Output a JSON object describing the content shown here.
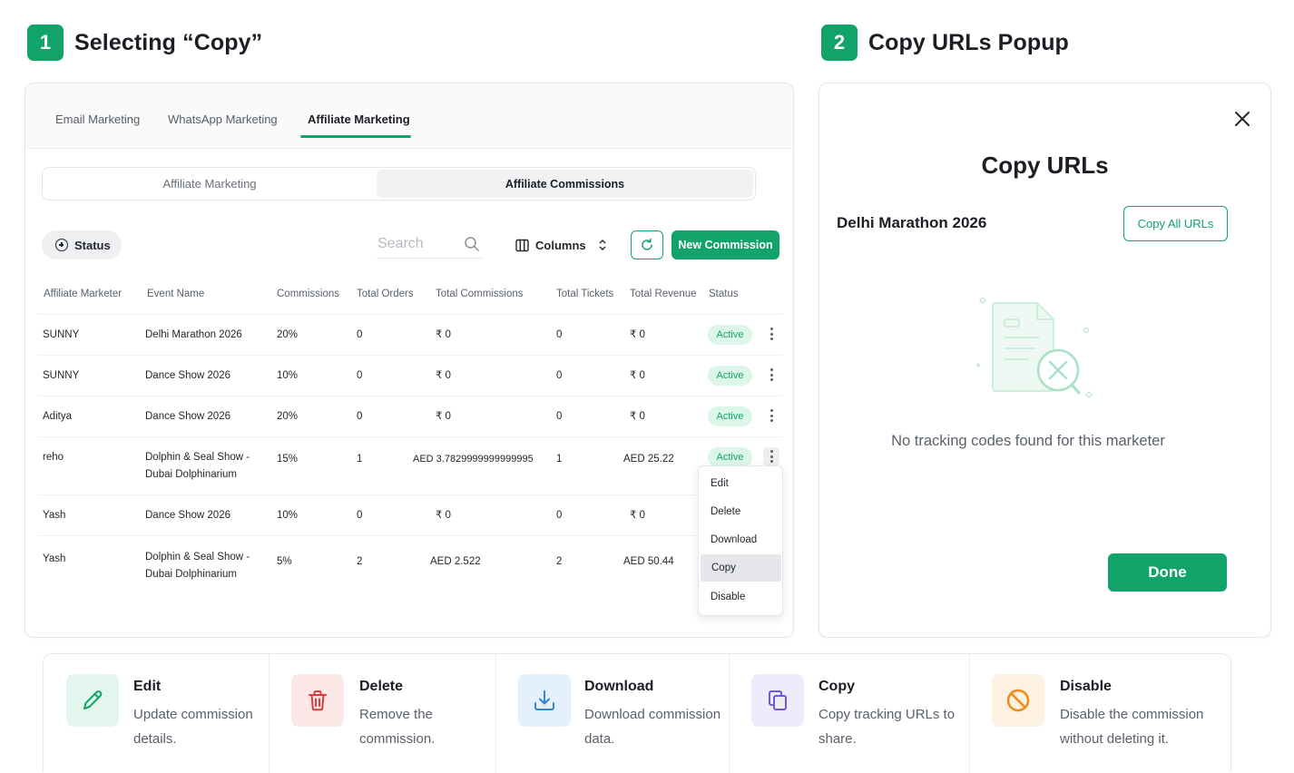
{
  "steps": [
    {
      "number": "1",
      "title": "Selecting “Copy”"
    },
    {
      "number": "2",
      "title": "Copy URLs Popup"
    }
  ],
  "top_tabs": [
    {
      "label": "Email Marketing",
      "active": false
    },
    {
      "label": "WhatsApp Marketing",
      "active": false
    },
    {
      "label": "Affiliate Marketing",
      "active": true
    }
  ],
  "segments": {
    "left": "Affiliate Marketing",
    "right": "Affiliate Commissions",
    "selected": "right"
  },
  "toolbar": {
    "status_label": "Status",
    "search_placeholder": "Search",
    "columns_label": "Columns",
    "new_commission_label": "New Commission"
  },
  "table": {
    "headers": [
      "Affiliate Marketer",
      "Event Name",
      "Commissions",
      "Total Orders",
      "Total Commissions",
      "Total Tickets",
      "Total Revenue",
      "Status"
    ],
    "rows": [
      {
        "marketer": "SUNNY",
        "event": "Delhi Marathon 2026",
        "event2": "",
        "commission": "20%",
        "orders": "0",
        "total_commissions": "₹ 0",
        "tickets": "0",
        "revenue": "₹ 0",
        "status": "Active"
      },
      {
        "marketer": "SUNNY",
        "event": "Dance Show 2026",
        "event2": "",
        "commission": "10%",
        "orders": "0",
        "total_commissions": "₹ 0",
        "tickets": "0",
        "revenue": "₹ 0",
        "status": "Active"
      },
      {
        "marketer": "Aditya",
        "event": "Dance Show 2026",
        "event2": "",
        "commission": "20%",
        "orders": "0",
        "total_commissions": "₹ 0",
        "tickets": "0",
        "revenue": "₹ 0",
        "status": "Active"
      },
      {
        "marketer": "reho",
        "event": "Dolphin & Seal Show -",
        "event2": "Dubai Dolphinarium",
        "commission": "15%",
        "orders": "1",
        "total_commissions": "AED 3.7829999999999995",
        "tickets": "1",
        "revenue": "AED 25.22",
        "status": "Active"
      },
      {
        "marketer": "Yash",
        "event": "Dance Show 2026",
        "event2": "",
        "commission": "10%",
        "orders": "0",
        "total_commissions": "₹ 0",
        "tickets": "0",
        "revenue": "₹ 0",
        "status": ""
      },
      {
        "marketer": "Yash",
        "event": "Dolphin & Seal Show -",
        "event2": "Dubai Dolphinarium",
        "commission": "5%",
        "orders": "2",
        "total_commissions": "AED 2.522",
        "tickets": "2",
        "revenue": "AED 50.44",
        "status": ""
      }
    ]
  },
  "row_menu": {
    "items": [
      "Edit",
      "Delete",
      "Download",
      "Copy",
      "Disable"
    ],
    "highlighted": "Copy"
  },
  "popup": {
    "title": "Copy URLs",
    "event_name": "Delhi Marathon 2026",
    "copy_all_label": "Copy All URLs",
    "empty_message": "No tracking codes found for this marketer",
    "done_label": "Done"
  },
  "legend": [
    {
      "icon": "pencil-icon",
      "title": "Edit",
      "line1": "Update commission",
      "line2": "details.",
      "icon_color": "#12a36b",
      "bg": "#e3f6ee"
    },
    {
      "icon": "trash-icon",
      "title": "Delete",
      "line1": "Remove the",
      "line2": "commission.",
      "icon_color": "#e0393e",
      "bg": "#fde8e8"
    },
    {
      "icon": "download-icon",
      "title": "Download",
      "line1": "Download commission",
      "line2": "data.",
      "icon_color": "#2f86d6",
      "bg": "#e4f0fb"
    },
    {
      "icon": "copy-icon",
      "title": "Copy",
      "line1": "Copy tracking URLs to",
      "line2": "share.",
      "icon_color": "#6b5bd6",
      "bg": "#eeebfb"
    },
    {
      "icon": "disable-icon",
      "title": "Disable",
      "line1": "Disable the commission",
      "line2": "without deleting it.",
      "icon_color": "#ef8a1a",
      "bg": "#fdf1e1"
    }
  ],
  "colors": {
    "accent": "#12a36b",
    "badge_bg": "#dcf6ea"
  }
}
